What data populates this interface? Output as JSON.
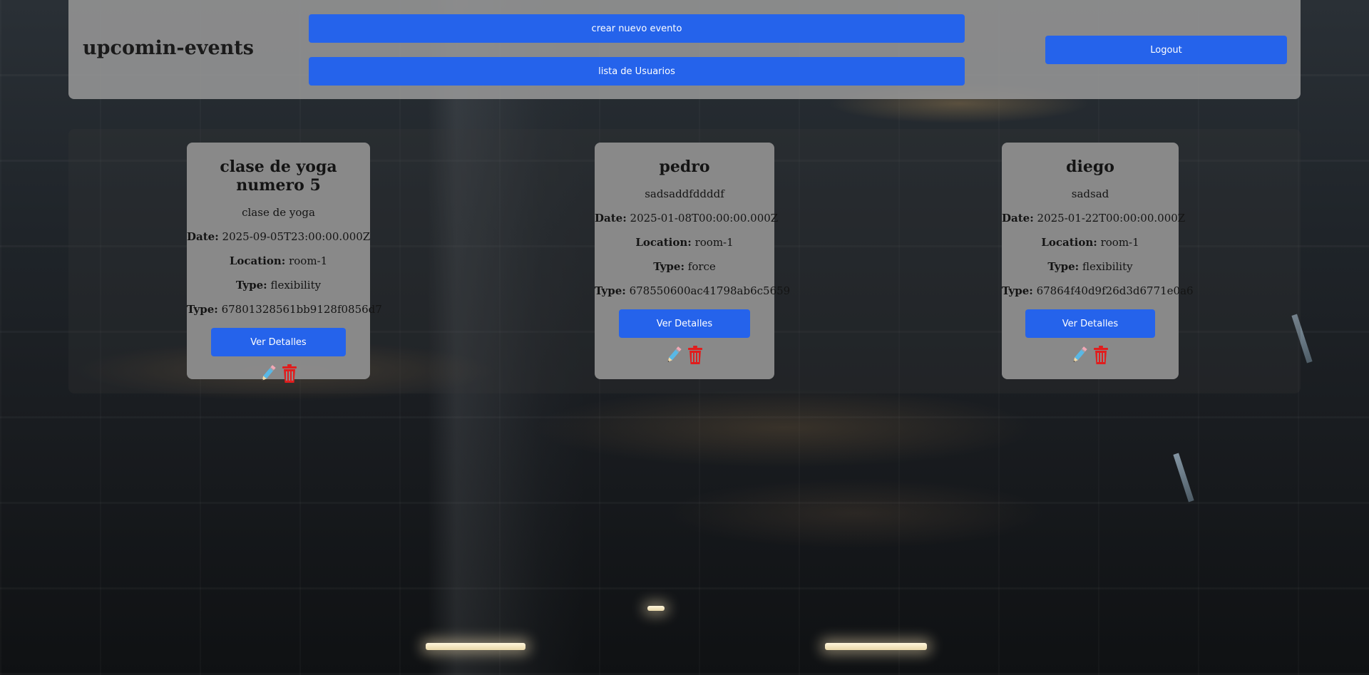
{
  "header": {
    "brand": "upcomin-events",
    "create_event_label": "crear nuevo evento",
    "users_list_label": "lista de Usuarios",
    "logout_label": "Logout"
  },
  "labels": {
    "date": "Date:",
    "location": "Location:",
    "type": "Type:"
  },
  "events": [
    {
      "title": "clase de yoga numero 5",
      "description": "clase de yoga",
      "date": "2025-09-05T23:00:00.000Z",
      "location": "room-1",
      "type": "flexibility",
      "id": "67801328561bb9128f0856d7",
      "details_label": "Ver Detalles"
    },
    {
      "title": "pedro",
      "description": "sadsaddfddddf",
      "date": "2025-01-08T00:00:00.000Z",
      "location": "room-1",
      "type": "force",
      "id": "678550600ac41798ab6c5659",
      "details_label": "Ver Detalles"
    },
    {
      "title": "diego",
      "description": "sadsad",
      "date": "2025-01-22T00:00:00.000Z",
      "location": "room-1",
      "type": "flexibility",
      "id": "67864f40d9f26d3d6771e0a6",
      "details_label": "Ver Detalles"
    }
  ],
  "icons": {
    "edit": "pencil-icon",
    "delete": "trash-icon"
  },
  "colors": {
    "primary_button": "#2563eb",
    "delete_icon": "#e11d1d",
    "header_bg": "#969696",
    "card_bg": "#8c8c8c"
  }
}
